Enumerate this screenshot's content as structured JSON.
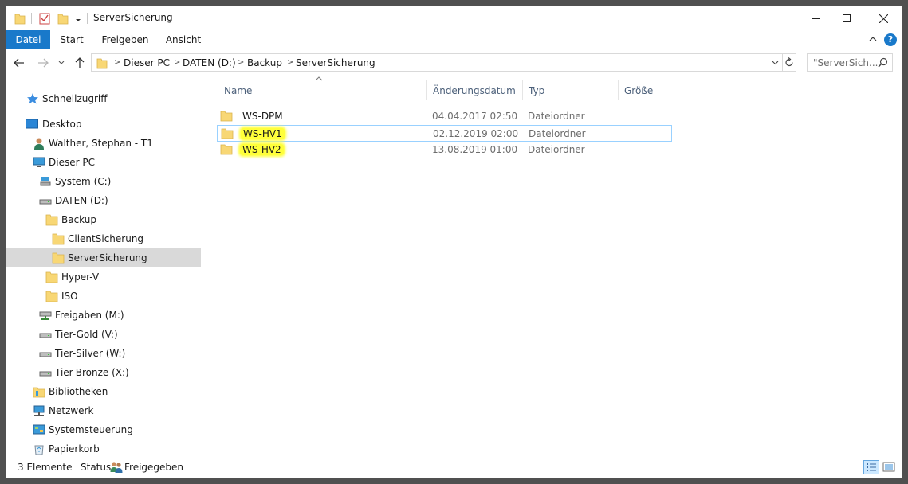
{
  "window": {
    "title": "ServerSicherung"
  },
  "ribbon": {
    "tabs": [
      "Datei",
      "Start",
      "Freigeben",
      "Ansicht"
    ],
    "help": "?"
  },
  "address": {
    "crumbs": [
      "Dieser PC",
      "DATEN (D:)",
      "Backup",
      "ServerSicherung"
    ],
    "search_placeholder": "\"ServerSich..."
  },
  "navpane": {
    "items": [
      {
        "label": "Schnellzugriff",
        "icon": "star-icon"
      },
      {
        "label": "Desktop",
        "icon": "desktop-icon"
      },
      {
        "label": "Walther, Stephan - T1",
        "icon": "user-icon"
      },
      {
        "label": "Dieser PC",
        "icon": "computer-icon"
      },
      {
        "label": "System (C:)",
        "icon": "system-drive-icon"
      },
      {
        "label": "DATEN (D:)",
        "icon": "drive-icon"
      },
      {
        "label": "Backup",
        "icon": "folder-icon"
      },
      {
        "label": "ClientSicherung",
        "icon": "folder-icon"
      },
      {
        "label": "ServerSicherung",
        "icon": "folder-icon"
      },
      {
        "label": "Hyper-V",
        "icon": "folder-icon"
      },
      {
        "label": "ISO",
        "icon": "folder-icon"
      },
      {
        "label": "Freigaben (M:)",
        "icon": "network-drive-icon"
      },
      {
        "label": "Tier-Gold (V:)",
        "icon": "drive-icon"
      },
      {
        "label": "Tier-Silver (W:)",
        "icon": "drive-icon"
      },
      {
        "label": "Tier-Bronze (X:)",
        "icon": "drive-icon"
      },
      {
        "label": "Bibliotheken",
        "icon": "library-icon"
      },
      {
        "label": "Netzwerk",
        "icon": "network-icon"
      },
      {
        "label": "Systemsteuerung",
        "icon": "control-panel-icon"
      },
      {
        "label": "Papierkorb",
        "icon": "recycle-bin-icon"
      }
    ],
    "selected": "ServerSicherung"
  },
  "filelist": {
    "columns": [
      "Name",
      "Änderungsdatum",
      "Typ",
      "Größe"
    ],
    "rows": [
      {
        "name": "WS-DPM",
        "date": "04.04.2017 02:50",
        "type": "Dateiordner",
        "size": ""
      },
      {
        "name": "WS-HV1",
        "date": "02.12.2019 02:00",
        "type": "Dateiordner",
        "size": ""
      },
      {
        "name": "WS-HV2",
        "date": "13.08.2019 01:00",
        "type": "Dateiordner",
        "size": ""
      }
    ]
  },
  "statusbar": {
    "count": "3 Elemente",
    "status_label": "Status:",
    "status_value": "Freigegeben"
  },
  "colors": {
    "accent": "#1979ca",
    "highlight": "#ffff3a",
    "folder": "#f8d775"
  }
}
